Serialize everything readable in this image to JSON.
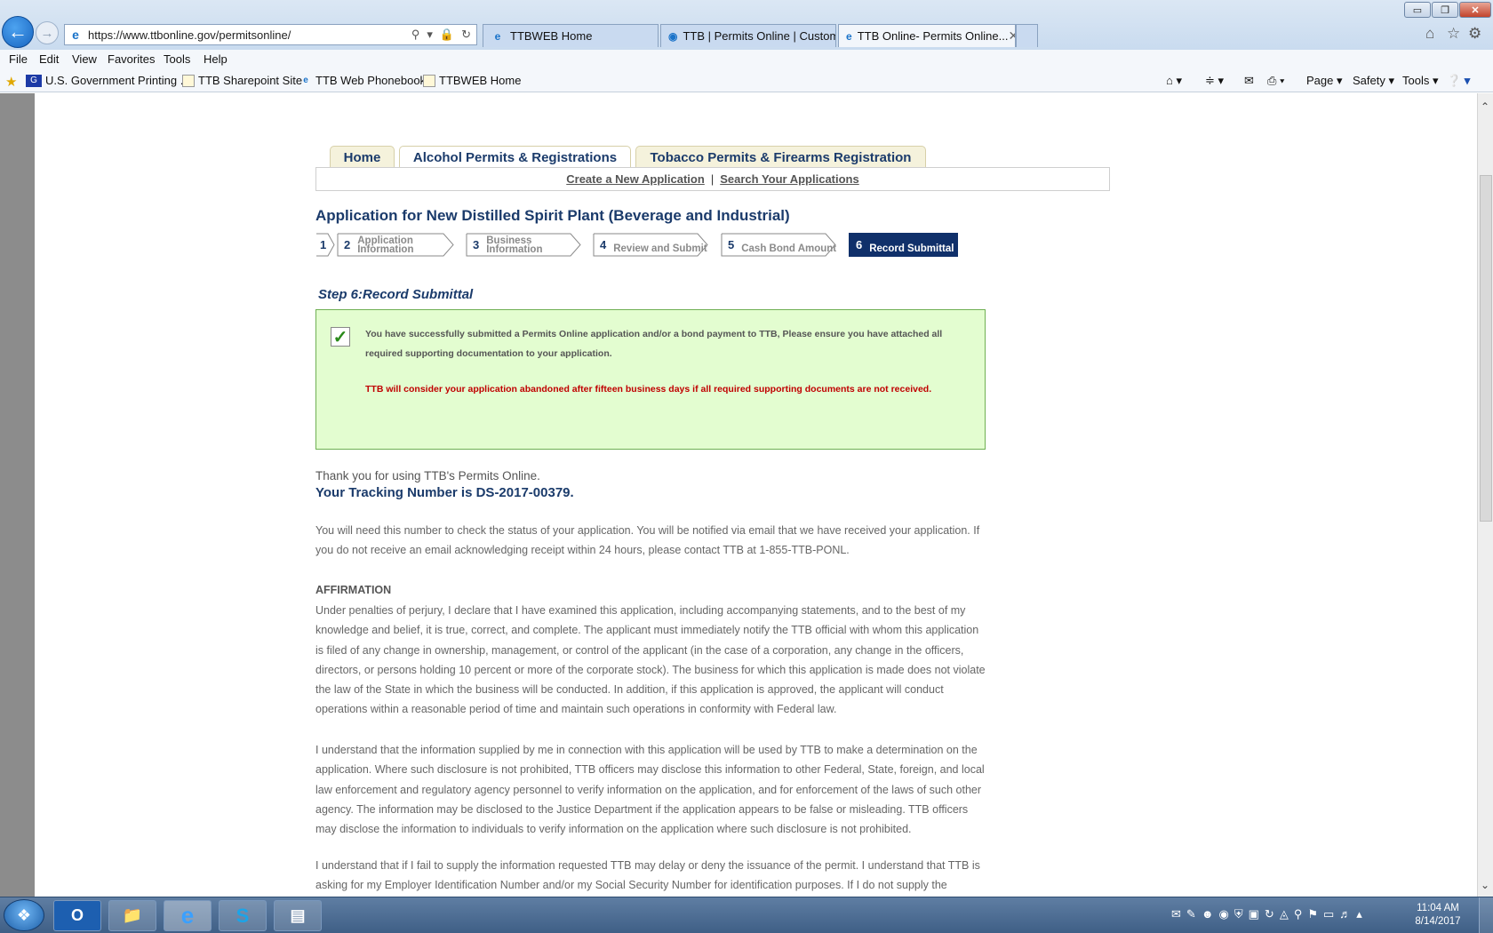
{
  "browser": {
    "address": "https://www.ttbonline.gov/permitsonline/",
    "tabs": [
      {
        "title": "TTBWEB Home"
      },
      {
        "title": "TTB | Permits Online | Custom..."
      },
      {
        "title": "TTB Online- Permits Online..."
      }
    ],
    "menu": [
      "File",
      "Edit",
      "View",
      "Favorites",
      "Tools",
      "Help"
    ],
    "favorites": [
      {
        "label": "U.S. Government Printing ..."
      },
      {
        "label": "TTB Sharepoint Site"
      },
      {
        "label": "TTB Web Phonebook"
      },
      {
        "label": "TTBWEB Home"
      }
    ],
    "command_bar": {
      "page": "Page ▾",
      "safety": "Safety ▾",
      "tools": "Tools ▾"
    },
    "window_buttons": {
      "min": "▭",
      "max": "❐",
      "close": "✕"
    }
  },
  "nav": {
    "tabs": [
      "Home",
      "Alcohol Permits & Registrations",
      "Tobacco Permits & Firearms Registration"
    ],
    "sub": {
      "create": "Create a New Application",
      "separator": "|",
      "search": "Search Your Applications"
    }
  },
  "page": {
    "title": "Application for New Distilled Spirit Plant (Beverage and Industrial)",
    "steps": [
      {
        "num": "1",
        "label": ""
      },
      {
        "num": "2",
        "label": "Application Information"
      },
      {
        "num": "3",
        "label": "Business Information"
      },
      {
        "num": "4",
        "label": "Review and Submit"
      },
      {
        "num": "5",
        "label": "Cash Bond Amount"
      },
      {
        "num": "6",
        "label": "Record Submittal"
      }
    ],
    "step_heading_prefix": "Step 6",
    "step_heading_sep": ":",
    "step_heading_name": "Record Submittal",
    "success_message": "You have successfully submitted a Permits Online application and/or a bond payment to TTB, Please ensure you have attached all required supporting documentation to your application.",
    "abandon_warning": "TTB will consider your application abandoned after fifteen business days if all required supporting documents are not received.",
    "thanks": "Thank you for using TTB's Permits Online.",
    "tracking": "Your Tracking Number is DS-2017-00379.",
    "status_info": "You will need this number to check the status of your application. You will be notified via email that we have received your application.  If you do not receive an email acknowledging receipt within 24 hours, please contact TTB at 1-855-TTB-PONL.",
    "affirmation_title": "AFFIRMATION",
    "affirmation_text": "Under penalties of perjury, I declare that I have examined this application, including accompanying statements, and to the best of my knowledge and belief, it is true, correct, and complete. The applicant must immediately notify the TTB official with whom this application is filed of any change in ownership, management, or control of the applicant (in the case of a corporation, any change in the officers, directors, or persons holding 10 percent or more of the corporate stock). The business for which this application is made does not violate the law of the State in which the business will be conducted. In addition, if this application is approved, the applicant will conduct operations within a reasonable period of time and maintain such operations in conformity with Federal law.",
    "info_use_text": "I understand that the information supplied by me in connection with this application will be used by TTB to make a determination on the application. Where such disclosure is not prohibited, TTB officers may disclose this information to other Federal, State, foreign, and local law enforcement and regulatory agency personnel to verify information on the application, and for enforcement of the laws of such other agency. The information may be disclosed to the Justice Department if the application appears to be false or misleading. TTB officers may disclose the information to individuals to verify information on the application where such disclosure is not prohibited.",
    "ein_text": "I understand that if I fail to supply the information requested TTB may delay or deny the issuance of the permit.  I understand that TTB is asking for my Employer Identification Number and/or my Social Security Number for identification purposes.  If I do not supply the numbers,"
  },
  "taskbar": {
    "clock_time": "11:04 AM",
    "clock_date": "8/14/2017"
  },
  "colors": {
    "accent": "#1b3b6b",
    "success_bg": "#e3fdd0",
    "warning": "#c00000",
    "active_step": "#10306a"
  }
}
